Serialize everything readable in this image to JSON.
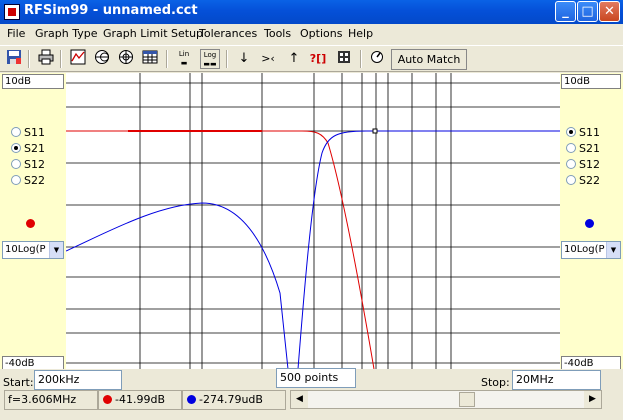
{
  "window": {
    "title": "RFSim99 - unnamed.cct",
    "min_glyph": "_",
    "max_glyph": "□",
    "close_glyph": "✕"
  },
  "menu": [
    "File",
    "Graph Type",
    "Graph Limit Setup",
    "Tolerances",
    "Tools",
    "Options",
    "Help"
  ],
  "toolbar": {
    "lin_label": "Lin",
    "log_label": "Log",
    "auto_match_label": "Auto Match",
    "down_arrow": "↓",
    "center_glyph": ">‹",
    "up_arrow": "↑",
    "help_glyph": "?[]"
  },
  "left_panel": {
    "top_scale": "10dB",
    "bottom_scale": "-40dB",
    "params": [
      "S11",
      "S21",
      "S12",
      "S22"
    ],
    "selected": "S21",
    "dot_color": "#E00000",
    "scale_mode": "10Log(P"
  },
  "right_panel": {
    "top_scale": "10dB",
    "bottom_scale": "-40dB",
    "params": [
      "S11",
      "S21",
      "S12",
      "S22"
    ],
    "selected": "S11",
    "dot_color": "#0000E0",
    "scale_mode": "10Log(P"
  },
  "graph": {
    "grid_color": "#000000",
    "s21_color": "#E00000",
    "s11_color": "#0000E0"
  },
  "bottom": {
    "start_label": "Start:",
    "start_value": "200kHz",
    "points": "500 points",
    "stop_label": "Stop:",
    "stop_value": "20MHz"
  },
  "status": {
    "freq": "f=3.606MHz",
    "red_value": "-41.99dB",
    "blue_value": "-274.79udB"
  }
}
